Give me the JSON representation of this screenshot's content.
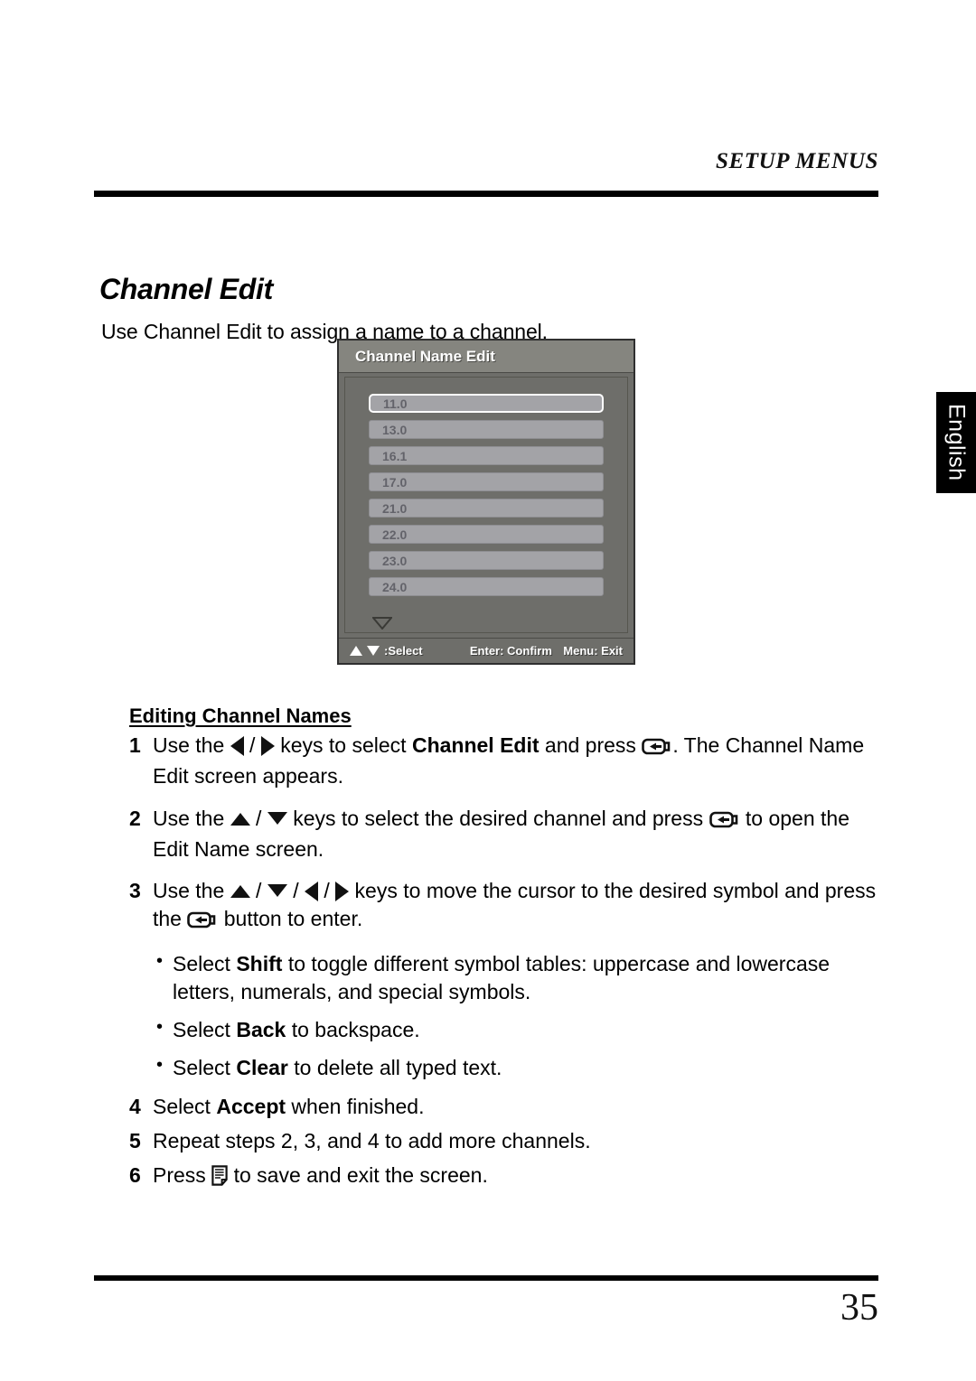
{
  "page": {
    "running_header": "SETUP MENUS",
    "side_tab": "English",
    "page_number": "35"
  },
  "section": {
    "title": "Channel Edit",
    "intro": "Use Channel Edit to assign a name to a channel."
  },
  "osd": {
    "title": "Channel Name Edit",
    "channels": [
      {
        "label": "11.0",
        "selected": true
      },
      {
        "label": "13.0",
        "selected": false
      },
      {
        "label": "16.1",
        "selected": false
      },
      {
        "label": "17.0",
        "selected": false
      },
      {
        "label": "21.0",
        "selected": false
      },
      {
        "label": "22.0",
        "selected": false
      },
      {
        "label": "23.0",
        "selected": false
      },
      {
        "label": "24.0",
        "selected": false
      }
    ],
    "scroll_indicator": "more-items-below",
    "footer": {
      "select_label": ":Select",
      "confirm_label": "Enter: Confirm",
      "exit_label": "Menu: Exit"
    }
  },
  "instructions": {
    "subhead": "Editing Channel Names",
    "steps": [
      {
        "num": "1",
        "parts": [
          {
            "t": "text",
            "v": "Use the "
          },
          {
            "t": "icon",
            "v": "left-arrow-key-icon"
          },
          {
            "t": "text",
            "v": " / "
          },
          {
            "t": "icon",
            "v": "right-arrow-key-icon"
          },
          {
            "t": "text",
            "v": " keys to select "
          },
          {
            "t": "bold",
            "v": "Channel Edit"
          },
          {
            "t": "text",
            "v": " and press "
          },
          {
            "t": "icon",
            "v": "enter-key-icon"
          },
          {
            "t": "text",
            "v": ". The Channel Name Edit screen appears."
          }
        ]
      },
      {
        "num": "2",
        "parts": [
          {
            "t": "text",
            "v": "Use the "
          },
          {
            "t": "icon",
            "v": "up-arrow-key-icon"
          },
          {
            "t": "text",
            "v": " / "
          },
          {
            "t": "icon",
            "v": "down-arrow-key-icon"
          },
          {
            "t": "text",
            "v": " keys to select the desired channel and press "
          },
          {
            "t": "icon",
            "v": "enter-key-icon"
          },
          {
            "t": "text",
            "v": " to open the Edit Name screen."
          }
        ]
      },
      {
        "num": "3",
        "parts": [
          {
            "t": "text",
            "v": "Use the "
          },
          {
            "t": "icon",
            "v": "up-arrow-key-icon"
          },
          {
            "t": "text",
            "v": " / "
          },
          {
            "t": "icon",
            "v": "down-arrow-key-icon"
          },
          {
            "t": "text",
            "v": " / "
          },
          {
            "t": "icon",
            "v": "left-arrow-key-icon"
          },
          {
            "t": "text",
            "v": " / "
          },
          {
            "t": "icon",
            "v": "right-arrow-key-icon"
          },
          {
            "t": "text",
            "v": " keys to move the cursor to the desired symbol and press the "
          },
          {
            "t": "icon",
            "v": "enter-key-icon"
          },
          {
            "t": "text",
            "v": " button to enter."
          }
        ]
      },
      {
        "num": "4",
        "parts": [
          {
            "t": "text",
            "v": "Select "
          },
          {
            "t": "bold",
            "v": "Accept"
          },
          {
            "t": "text",
            "v": " when finished."
          }
        ]
      },
      {
        "num": "5",
        "parts": [
          {
            "t": "text",
            "v": "Repeat steps 2, 3, and 4 to add more channels."
          }
        ]
      },
      {
        "num": "6",
        "parts": [
          {
            "t": "text",
            "v": "Press "
          },
          {
            "t": "icon",
            "v": "menu-key-icon"
          },
          {
            "t": "text",
            "v": " to save and exit the screen."
          }
        ]
      }
    ],
    "bullets": [
      {
        "marker": "•",
        "parts": [
          {
            "t": "text",
            "v": "Select "
          },
          {
            "t": "bold",
            "v": "Shift"
          },
          {
            "t": "text",
            "v": " to toggle different symbol tables: uppercase and lowercase letters, numerals, and special symbols."
          }
        ]
      },
      {
        "marker": "•",
        "parts": [
          {
            "t": "text",
            "v": "Select "
          },
          {
            "t": "bold",
            "v": "Back"
          },
          {
            "t": "text",
            "v": " to backspace."
          }
        ]
      },
      {
        "marker": "•",
        "parts": [
          {
            "t": "text",
            "v": "Select "
          },
          {
            "t": "bold",
            "v": "Clear"
          },
          {
            "t": "text",
            "v": " to delete all typed text."
          }
        ]
      }
    ]
  },
  "colors": {
    "osd_body": "#6e6e6a",
    "osd_titlebar": "#85857f",
    "osd_row": "#a3a3a7",
    "osd_row_text": "#63636a",
    "ink": "#000000",
    "tab_bg": "#000000"
  }
}
